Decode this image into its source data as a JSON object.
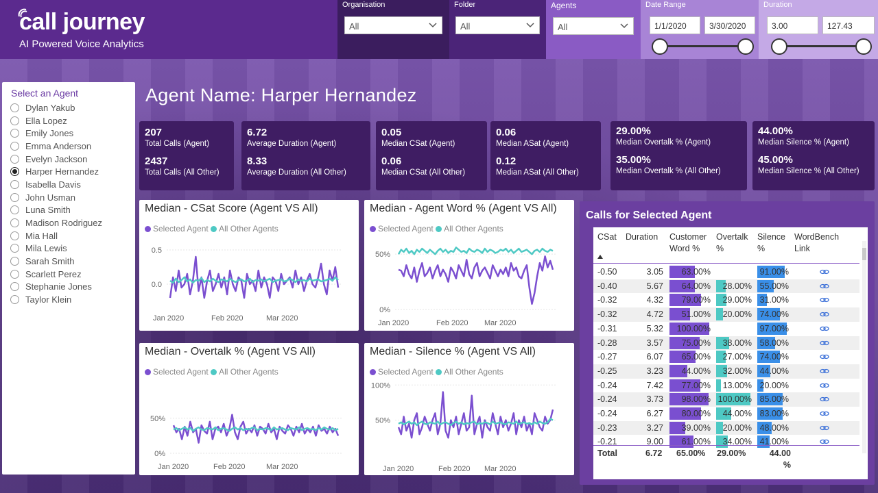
{
  "brand": {
    "name": "call journey",
    "tagline": "AI Powered Voice Analytics"
  },
  "filters": {
    "organisation": {
      "label": "Organisation",
      "value": "All"
    },
    "folder": {
      "label": "Folder",
      "value": "All"
    },
    "agents": {
      "label": "Agents",
      "value": "All"
    },
    "date_range": {
      "label": "Date Range",
      "start": "1/1/2020",
      "end": "3/30/2020"
    },
    "duration": {
      "label": "Duration",
      "min": "3.00",
      "max": "127.43"
    }
  },
  "agent_panel": {
    "title": "Select an Agent",
    "agents": [
      "Dylan Yakub",
      "Ella Lopez",
      "Emily Jones",
      "Emma Anderson",
      "Evelyn Jackson",
      "Harper Hernandez",
      "Isabella Davis",
      "John Usman",
      "Luna Smith",
      "Madison Rodriguez",
      "Mia Hall",
      "Mila Lewis",
      "Sarah Smith",
      "Scarlett Perez",
      "Stephanie Jones",
      "Taylor Klein"
    ],
    "selected": "Harper Hernandez"
  },
  "agent_heading": "Agent Name: Harper Hernandez",
  "kpis": [
    {
      "v1": "207",
      "l1": "Total Calls (Agent)",
      "v2": "2437",
      "l2": "Total Calls (All Other)"
    },
    {
      "v1": "6.72",
      "l1": "Average Duration (Agent)",
      "v2": "8.33",
      "l2": "Average Duration (All Other)"
    },
    {
      "v1": "0.05",
      "l1": "Median CSat (Agent)",
      "v2": "0.06",
      "l2": "Median CSat (All Other)"
    },
    {
      "v1": "0.06",
      "l1": "Median ASat (Agent)",
      "v2": "0.12",
      "l2": "Median ASat (All Other)"
    },
    {
      "v1": "29.00%",
      "l1": "Median Overtalk % (Agent)",
      "v2": "35.00%",
      "l2": "Median Overtalk % (All Other)"
    },
    {
      "v1": "44.00%",
      "l1": "Median Silence % (Agent)",
      "v2": "45.00%",
      "l2": "Median Silence % (All Other)"
    }
  ],
  "legend": {
    "selected": "Selected Agent",
    "others": "All Other Agents"
  },
  "colors": {
    "selected": "#7b4fd0",
    "others": "#4ec9c4",
    "blue": "#3a8fe8"
  },
  "chart_data": [
    {
      "type": "line",
      "title": "Median - CSat Score (Agent VS All)",
      "ylim": [
        -0.3,
        0.6
      ],
      "yticks": [
        "0.5",
        "0.0"
      ],
      "ytick_values": [
        0.5,
        0.0
      ],
      "xticks": [
        "Jan 2020",
        "Feb 2020",
        "Mar 2020"
      ],
      "series": [
        {
          "name": "Selected Agent",
          "values": [
            -0.2,
            0.1,
            -0.1,
            0.2,
            -0.05,
            0.0,
            0.15,
            -0.15,
            0.05,
            0.4,
            -0.1,
            0.1,
            -0.2,
            0.05,
            0.2,
            -0.1,
            0.0,
            0.15,
            -0.05,
            0.1,
            -0.15,
            0.2,
            0.0,
            -0.1,
            0.1,
            0.05,
            -0.2,
            0.15,
            0.0,
            0.05,
            -0.1,
            0.2,
            -0.05,
            0.1,
            0.0,
            -0.2,
            0.1,
            0.05,
            -0.1,
            0.15,
            0.0,
            0.05,
            0.1,
            -0.05,
            0.2,
            0.0,
            0.1,
            -0.1,
            0.05,
            0.15,
            0.0,
            -0.05,
            0.1,
            0.3,
            0.0,
            -0.15,
            0.2,
            0.05,
            0.25,
            -0.05
          ]
        },
        {
          "name": "All Other Agents",
          "values": [
            0.05,
            0.02,
            0.08,
            0.03,
            0.06,
            0.1,
            0.04,
            0.07,
            0.02,
            0.06,
            0.05,
            0.09,
            0.03,
            0.06,
            0.04,
            0.08,
            0.05,
            0.03,
            0.07,
            0.06,
            0.04,
            0.08,
            0.05,
            0.03,
            0.06,
            0.07,
            0.04,
            0.05,
            0.08,
            0.03,
            0.06,
            0.05,
            0.07,
            0.04,
            0.06,
            0.08,
            0.03,
            0.05,
            0.06,
            0.07,
            0.04,
            0.05,
            0.08,
            0.06,
            0.03,
            0.07,
            0.05,
            0.06,
            0.04,
            0.08,
            0.05,
            0.06,
            0.07,
            0.04,
            0.05,
            0.06,
            0.08,
            0.05,
            0.1,
            0.06
          ]
        }
      ]
    },
    {
      "type": "line",
      "title": "Median - Agent Word % (Agent VS All)",
      "ylim": [
        0,
        60
      ],
      "yticks": [
        "50%",
        "0%"
      ],
      "ytick_values": [
        50,
        0
      ],
      "xticks": [
        "Jan 2020",
        "Feb 2020",
        "Mar 2020"
      ],
      "series": [
        {
          "name": "Selected Agent",
          "values": [
            36,
            35,
            30,
            40,
            32,
            28,
            38,
            25,
            35,
            42,
            30,
            33,
            38,
            28,
            35,
            40,
            30,
            36,
            32,
            25,
            38,
            34,
            28,
            40,
            35,
            30,
            45,
            32,
            28,
            38,
            42,
            30,
            35,
            38,
            33,
            28,
            40,
            35,
            30,
            36,
            32,
            38,
            30,
            42,
            35,
            38,
            30,
            28,
            35,
            40,
            20,
            5,
            15,
            30,
            42,
            35,
            48,
            38,
            44,
            36
          ]
        },
        {
          "name": "All Other Agents",
          "values": [
            50,
            54,
            52,
            55,
            51,
            53,
            50,
            54,
            52,
            55,
            53,
            51,
            54,
            52,
            50,
            53,
            55,
            52,
            54,
            51,
            53,
            52,
            56,
            54,
            52,
            53,
            51,
            55,
            53,
            52,
            54,
            53,
            51,
            55,
            52,
            54,
            53,
            51,
            52,
            54,
            53,
            55,
            52,
            54,
            51,
            53,
            55,
            52,
            53,
            54,
            52,
            50,
            53,
            54,
            52,
            55,
            53,
            52,
            54,
            53
          ]
        }
      ]
    },
    {
      "type": "line",
      "title": "Median - Overtalk % (Agent VS All)",
      "ylim": [
        0,
        85
      ],
      "yticks": [
        "50%",
        "0%"
      ],
      "ytick_values": [
        50,
        0
      ],
      "xticks": [
        "Jan 2020",
        "Feb 2020",
        "Mar 2020"
      ],
      "series": [
        {
          "name": "Selected Agent",
          "values": [
            40,
            30,
            35,
            20,
            38,
            25,
            45,
            30,
            35,
            15,
            40,
            32,
            28,
            45,
            20,
            35,
            38,
            30,
            42,
            25,
            35,
            55,
            30,
            20,
            38,
            45,
            28,
            35,
            30,
            40,
            25,
            38,
            35,
            28,
            42,
            30,
            35,
            20,
            38,
            32,
            28,
            40,
            35,
            25,
            38,
            30,
            42,
            28,
            35,
            30,
            38,
            25,
            40,
            32,
            35,
            28,
            38,
            30,
            35,
            25
          ]
        },
        {
          "name": "All Other Agents",
          "values": [
            34,
            36,
            33,
            35,
            37,
            34,
            36,
            32,
            35,
            37,
            34,
            33,
            36,
            35,
            34,
            37,
            33,
            35,
            36,
            34,
            32,
            35,
            37,
            34,
            36,
            33,
            35,
            34,
            36,
            37,
            33,
            35,
            34,
            36,
            35,
            33,
            37,
            34,
            35,
            36,
            34,
            33,
            36,
            35,
            34,
            37,
            33,
            35,
            36,
            34,
            35,
            33,
            36,
            34,
            37,
            35,
            34,
            36,
            33,
            35
          ]
        }
      ]
    },
    {
      "type": "line",
      "title": "Median - Silence % (Agent VS All)",
      "ylim": [
        0,
        110
      ],
      "yticks": [
        "100%",
        "50%"
      ],
      "ytick_values": [
        100,
        50
      ],
      "xticks": [
        "Jan 2020",
        "Feb 2020",
        "Mar 2020"
      ],
      "series": [
        {
          "name": "Selected Agent",
          "values": [
            40,
            30,
            55,
            35,
            45,
            25,
            50,
            60,
            30,
            40,
            55,
            45,
            35,
            50,
            60,
            30,
            45,
            90,
            35,
            25,
            50,
            40,
            55,
            30,
            45,
            60,
            35,
            40,
            85,
            30,
            45,
            55,
            25,
            50,
            40,
            35,
            60,
            45,
            30,
            55,
            40,
            50,
            35,
            45,
            60,
            30,
            50,
            40,
            55,
            35,
            45,
            30,
            60,
            50,
            40,
            35,
            55,
            45,
            50,
            65
          ]
        },
        {
          "name": "All Other Agents",
          "values": [
            45,
            47,
            44,
            46,
            48,
            45,
            47,
            43,
            46,
            48,
            45,
            44,
            47,
            46,
            45,
            48,
            44,
            46,
            47,
            45,
            43,
            46,
            48,
            45,
            47,
            44,
            46,
            45,
            47,
            48,
            44,
            46,
            45,
            47,
            46,
            44,
            48,
            45,
            46,
            47,
            45,
            44,
            47,
            46,
            45,
            48,
            44,
            46,
            47,
            45,
            46,
            44,
            47,
            45,
            48,
            46,
            45,
            47,
            52,
            50
          ]
        }
      ]
    }
  ],
  "calls_table": {
    "title": "Calls for Selected Agent",
    "columns": [
      "CSat",
      "Duration",
      "Customer Word %",
      "Overtalk %",
      "Silence %",
      "WordBench Link"
    ],
    "rows": [
      {
        "csat": "-0.50",
        "duration": "3.05",
        "customer_word": "63.00%",
        "cw": 63,
        "overtalk": "",
        "ot": 0,
        "silence": "91.00%",
        "si": 91
      },
      {
        "csat": "-0.40",
        "duration": "5.67",
        "customer_word": "64.00%",
        "cw": 64,
        "overtalk": "28.00%",
        "ot": 28,
        "silence": "55.00%",
        "si": 55
      },
      {
        "csat": "-0.32",
        "duration": "4.32",
        "customer_word": "79.00%",
        "cw": 79,
        "overtalk": "29.00%",
        "ot": 29,
        "silence": "31.00%",
        "si": 31
      },
      {
        "csat": "-0.32",
        "duration": "4.72",
        "customer_word": "51.00%",
        "cw": 51,
        "overtalk": "20.00%",
        "ot": 20,
        "silence": "74.00%",
        "si": 74
      },
      {
        "csat": "-0.31",
        "duration": "5.32",
        "customer_word": "100.00%",
        "cw": 100,
        "overtalk": "",
        "ot": 0,
        "silence": "97.00%",
        "si": 97
      },
      {
        "csat": "-0.28",
        "duration": "3.57",
        "customer_word": "75.00%",
        "cw": 75,
        "overtalk": "38.00%",
        "ot": 38,
        "silence": "58.00%",
        "si": 58
      },
      {
        "csat": "-0.27",
        "duration": "6.07",
        "customer_word": "65.00%",
        "cw": 65,
        "overtalk": "27.00%",
        "ot": 27,
        "silence": "74.00%",
        "si": 74
      },
      {
        "csat": "-0.25",
        "duration": "3.23",
        "customer_word": "44.00%",
        "cw": 44,
        "overtalk": "32.00%",
        "ot": 32,
        "silence": "44.00%",
        "si": 44
      },
      {
        "csat": "-0.24",
        "duration": "7.42",
        "customer_word": "77.00%",
        "cw": 77,
        "overtalk": "13.00%",
        "ot": 13,
        "silence": "20.00%",
        "si": 20
      },
      {
        "csat": "-0.24",
        "duration": "3.73",
        "customer_word": "98.00%",
        "cw": 98,
        "overtalk": "100.00%",
        "ot": 100,
        "silence": "85.00%",
        "si": 85
      },
      {
        "csat": "-0.24",
        "duration": "6.27",
        "customer_word": "80.00%",
        "cw": 80,
        "overtalk": "44.00%",
        "ot": 44,
        "silence": "83.00%",
        "si": 83
      },
      {
        "csat": "-0.23",
        "duration": "3.27",
        "customer_word": "39.00%",
        "cw": 39,
        "overtalk": "20.00%",
        "ot": 20,
        "silence": "48.00%",
        "si": 48
      },
      {
        "csat": "-0.21",
        "duration": "9.00",
        "customer_word": "61.00%",
        "cw": 61,
        "overtalk": "34.00%",
        "ot": 34,
        "silence": "41.00%",
        "si": 41
      }
    ],
    "totals": {
      "label": "Total",
      "duration": "6.72",
      "customer_word": "65.00%",
      "overtalk": "29.00%",
      "silence": "44.00 %"
    }
  }
}
